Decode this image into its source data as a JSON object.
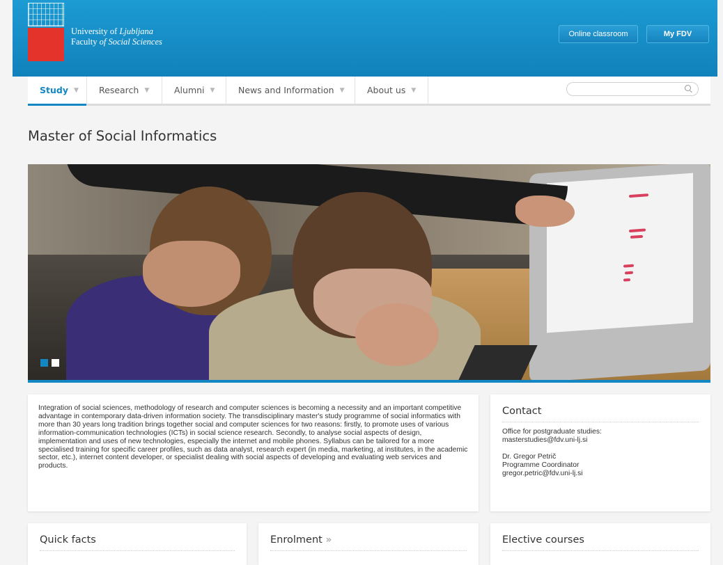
{
  "header": {
    "university_line1_prefix": "University of ",
    "university_line1_name": "Ljubljana",
    "university_line2_prefix": "Faculty ",
    "university_line2_name": "of Social Sciences",
    "online_classroom_label": "Online classroom",
    "my_fdv_label": "My FDV",
    "accent_color": "#1a8fc9",
    "logo_red": "#e3332a"
  },
  "nav": {
    "items": [
      {
        "label": "Study",
        "active": true
      },
      {
        "label": "Research",
        "active": false
      },
      {
        "label": "Alumni",
        "active": false
      },
      {
        "label": "News and Information",
        "active": false
      },
      {
        "label": "About us",
        "active": false
      }
    ],
    "search_placeholder": ""
  },
  "page": {
    "title": "Master of Social Informatics"
  },
  "slider": {
    "slide_count": 2,
    "active_index": 0
  },
  "intro": {
    "text": "Integration of social sciences, methodology of research and computer sciences is becoming a necessity and an important competitive advantage in contemporary data-driven information society. The transdisciplinary master's study programme of social informatics with more than 30 years long tradition brings together social and computer sciences for two reasons: firstly, to promote uses of various information-communication technologies (ICTs) in social science research. Secondly, to analyse social aspects of design, implementation and uses of new technologies, especially the internet and mobile phones. Syllabus can be tailored for a more specialised training for specific career profiles, such as data analyst, research expert (in media, marketing, at institutes, in the academic sector, etc.), internet content developer, or specialist dealing with social aspects of developing and evaluating web services and products."
  },
  "contact": {
    "title": "Contact",
    "office_label": "Office for postgraduate studies:",
    "office_email": "masterstudies@fdv.uni-lj.si",
    "person_name": "Dr. Gregor Petrič",
    "person_role": "Programme Coordinator",
    "person_email": "gregor.petric@fdv.uni-lj.si"
  },
  "cards": {
    "quick_facts": "Quick facts",
    "enrolment": "Enrolment",
    "enrolment_arrow": "»",
    "elective_courses": "Elective courses"
  }
}
